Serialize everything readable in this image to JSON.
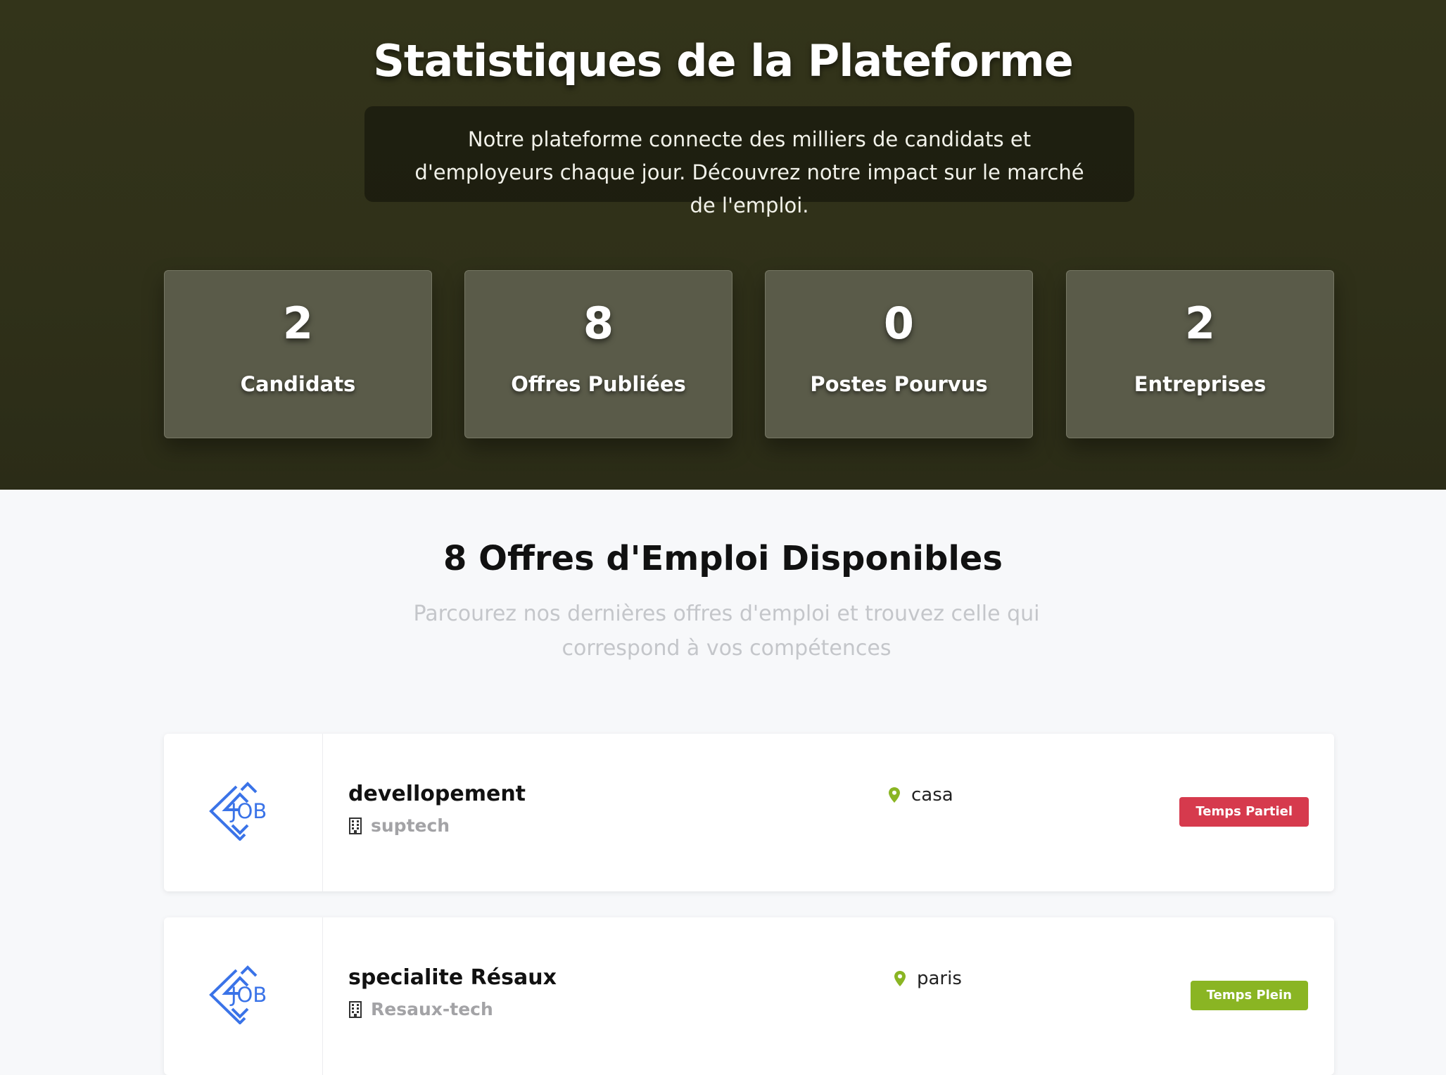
{
  "stats": {
    "title": "Statistiques de la Plateforme",
    "intro": "Notre plateforme connecte des milliers de candidats et d'employeurs chaque jour. Découvrez notre impact sur le marché de l'emploi.",
    "cards": [
      {
        "value": "2",
        "label": "Candidats"
      },
      {
        "value": "8",
        "label": "Offres Publiées"
      },
      {
        "value": "0",
        "label": "Postes Pourvus"
      },
      {
        "value": "2",
        "label": "Entreprises"
      }
    ]
  },
  "jobs": {
    "title": "8 Offres d'Emploi Disponibles",
    "subtitle": "Parcourez nos dernières offres d'emploi et trouvez celle qui correspond à vos compétences",
    "items": [
      {
        "title": "devellopement",
        "company": "suptech",
        "location": "casa",
        "type": "Temps Partiel",
        "type_color": "#d63a4d",
        "logo_text": "JOB"
      },
      {
        "title": "specialite Résaux",
        "company": "Resaux-tech",
        "location": "paris",
        "type": "Temps Plein",
        "type_color": "#8ab523",
        "logo_text": "JOB"
      }
    ]
  },
  "icons": {
    "company": "building-icon",
    "location": "map-pin-icon",
    "logo": "job-logo-icon"
  },
  "colors": {
    "hero_bg": "#2f3019",
    "stat_card": "#5a5b49",
    "logo_blue": "#3a73e8",
    "pin_green": "#8ab523"
  }
}
